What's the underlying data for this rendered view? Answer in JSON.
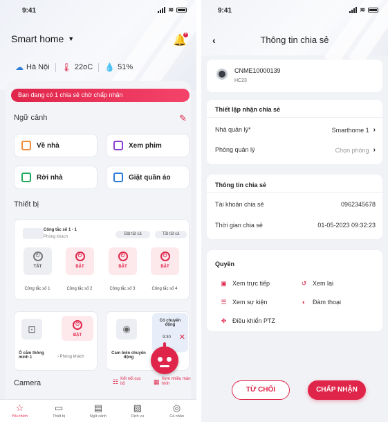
{
  "status_time": "9:41",
  "home": {
    "title": "Smart home",
    "weather": {
      "city": "Hà Nội",
      "temperature": "22oC",
      "humidity": "51%"
    },
    "banner": "Bạn đang có 1 chia sẻ chờ chấp nhận",
    "scenes_title": "Ngữ cảnh",
    "scenes": [
      {
        "label": "Về nhà",
        "color": "#f08c3a"
      },
      {
        "label": "Xem phim",
        "color": "#8b3fd6"
      },
      {
        "label": "Rời nhà",
        "color": "#1fa85c"
      },
      {
        "label": "Giặt quần áo",
        "color": "#2b7bd8"
      }
    ],
    "devices_title": "Thiết bị",
    "switch_group": {
      "name": "Công tắc số 1 - 1",
      "room": "Phòng khách",
      "all_on": "Bật tất cả",
      "all_off": "Tắt tất cả",
      "switches": [
        {
          "state": "TẮT",
          "label": "Công tắc số 1"
        },
        {
          "state": "BẬT",
          "label": "Công tắc số 2"
        },
        {
          "state": "BẬT",
          "label": "Công tắc số 3"
        },
        {
          "state": "BẬT",
          "label": "Công tắc số 4"
        }
      ]
    },
    "socket": {
      "name": "Ổ cắm thông minh 1",
      "room": "Phòng khách",
      "state": "BẬT"
    },
    "sensor": {
      "name": "Cảm biến chuyển động",
      "status": "Có chuyển động",
      "time": "9:30"
    },
    "camera_title": "Camera",
    "camera_actions": {
      "connect": "Kết nối cục bộ",
      "watch": "Xem nhiều màn hình"
    },
    "tabs": [
      "Yêu thích",
      "Thiết bị",
      "Ngữ cảnh",
      "Dịch vụ",
      "Cá nhân"
    ]
  },
  "share": {
    "title": "Thông tin chia sẻ",
    "device": {
      "code": "CNME10000139",
      "model": "HC23"
    },
    "settings_title": "Thiết lập nhận chia sẻ",
    "manager_label": "Nhà quản lý*",
    "manager_value": "Smarthome 1",
    "room_label": "Phòng quản lý",
    "room_placeholder": "Chọn phòng",
    "info_title": "Thông tin chia sẻ",
    "account_label": "Tài khoản chia sẻ",
    "account_value": "0962345678",
    "time_label": "Thời gian chia sẻ",
    "time_value": "01-05-2023 09:32:23",
    "perm_title": "Quyền",
    "permissions": [
      "Xem trực tiếp",
      "Xem lại",
      "Xem sự kiện",
      "Đàm thoại",
      "Điều khiển PTZ"
    ],
    "reject": "TỪ CHỐI",
    "accept": "CHẤP NHẬN"
  },
  "icons": {
    "dropdown": "caret-down-icon",
    "bell": "bell-icon",
    "weather": "cloud-sun-icon",
    "temperature": "thermometer-icon",
    "humidity": "droplet-icon",
    "edit": "pencil-icon",
    "back": "back-arrow-icon"
  },
  "colors": {
    "accent": "#e0254a"
  }
}
